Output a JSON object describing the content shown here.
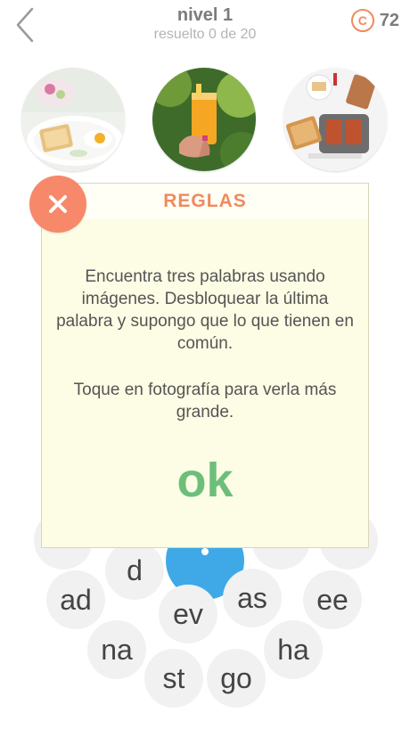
{
  "header": {
    "title": "nivel 1",
    "subtitle": "resuelto 0 de 20",
    "coins": "72",
    "coin_symbol": "C"
  },
  "photos": [
    {
      "subject": "breakfast-plate"
    },
    {
      "subject": "orange-juice-glass"
    },
    {
      "subject": "toaster"
    }
  ],
  "letters": [
    {
      "text": "d"
    },
    {
      "text": "ad"
    },
    {
      "text": "ev"
    },
    {
      "text": "as"
    },
    {
      "text": "ee"
    },
    {
      "text": "na"
    },
    {
      "text": "ha"
    },
    {
      "text": "st"
    },
    {
      "text": "go"
    }
  ],
  "modal": {
    "title": "REGLAS",
    "body": "Encuentra tres palabras usando imágenes. Desbloquear la última palabra y supongo que lo que tienen en común.",
    "hint": "Toque en fotografía para verla más grande.",
    "ok_label": "ok"
  },
  "colors": {
    "accent": "#f08a5d",
    "close": "#f7886a",
    "ok": "#6cbf7a",
    "center": "#3fa9e8",
    "modal_bg": "#fdfce4"
  }
}
